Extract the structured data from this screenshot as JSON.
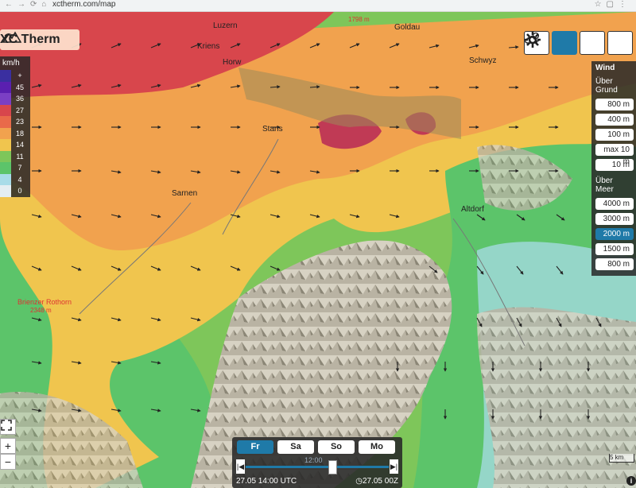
{
  "browser": {
    "url": "xctherm.com/map"
  },
  "app": {
    "title": "XC Therm"
  },
  "legend": {
    "unit": "km/h",
    "items": [
      {
        "label": "+",
        "color": "#3a2fa0"
      },
      {
        "label": "45",
        "color": "#5a1fb0"
      },
      {
        "label": "36",
        "color": "#7b3fc4"
      },
      {
        "label": "27",
        "color": "#d8464c"
      },
      {
        "label": "23",
        "color": "#e96a4a"
      },
      {
        "label": "18",
        "color": "#f1a24e"
      },
      {
        "label": "14",
        "color": "#f0c54e"
      },
      {
        "label": "11",
        "color": "#7ec65a"
      },
      {
        "label": "7",
        "color": "#5cc46a"
      },
      {
        "label": "4",
        "color": "#a8dce8"
      },
      {
        "label": "0",
        "color": "#e4eef2"
      }
    ]
  },
  "top_controls": [
    {
      "icon": "cloud-sun-icon",
      "active": false
    },
    {
      "icon": "wind-icon",
      "active": true
    },
    {
      "icon": "thunder-cloud-icon",
      "active": false
    },
    {
      "icon": "gear-icon",
      "active": false
    }
  ],
  "wind_panel": {
    "title": "Wind",
    "ground_label": "Über Grund",
    "ground_options": [
      "800 m",
      "400 m",
      "100 m",
      "max 10 m",
      "10 m"
    ],
    "sea_label": "Über Meer",
    "sea_options": [
      "4000 m",
      "3000 m",
      "2000 m",
      "1500 m",
      "800 m"
    ],
    "selected": "2000 m"
  },
  "places": [
    {
      "name": "Luzern"
    },
    {
      "name": "Kriens"
    },
    {
      "name": "Horw"
    },
    {
      "name": "Goldau"
    },
    {
      "name": "Schwyz"
    },
    {
      "name": "Stans"
    },
    {
      "name": "Sarnen"
    },
    {
      "name": "Altdorf"
    },
    {
      "name": "Brienzer Rothorn"
    }
  ],
  "peaks": [
    {
      "name": "1798 m"
    },
    {
      "name": "2348 m"
    }
  ],
  "timebar": {
    "days": [
      "Fr",
      "Sa",
      "So",
      "Mo"
    ],
    "selected_day": "Fr",
    "current": "27.05 14:00 UTC",
    "run": "27.05 00Z",
    "slider_tip": "12:00"
  },
  "scale": {
    "label": "5 km"
  },
  "zoom": {
    "plus": "+",
    "minus": "−"
  }
}
